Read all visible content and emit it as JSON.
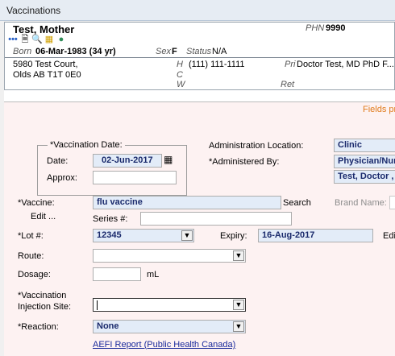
{
  "window": {
    "title": "Vaccinations"
  },
  "patient": {
    "name": "Test, Mother",
    "phn_label": "PHN",
    "phn": "9990",
    "born_label": "Born",
    "born": "06-Mar-1983 (34 yr)",
    "sex_label": "Sex",
    "sex": "F",
    "status_label": "Status",
    "status": "N/A",
    "address_line1": "5980 Test Court,",
    "address_line2": "Olds AB  T1T 0E0",
    "h_label": "H",
    "h_phone": "(111) 111-1111",
    "c_label": "C",
    "w_label": "W",
    "pri_label": "Pri",
    "pri": "Doctor Test, MD PhD F...",
    "ret_label": "Ret"
  },
  "form": {
    "fields_note": "Fields pr",
    "vaccination_date_group": "*Vaccination Date:",
    "date_label": "Date:",
    "date_value": "02-Jun-2017",
    "approx_label": "Approx:",
    "admin_location_label": "Administration Location:",
    "admin_location_value": "Clinic",
    "administered_by_label": "*Administered By:",
    "administered_by_value1": "Physician/Nur",
    "administered_by_value2": "Test, Doctor ,",
    "vaccine_label": "*Vaccine:",
    "vaccine_value": "flu vaccine",
    "search_label": "Search",
    "brand_name_label": "Brand Name:",
    "edit_label": "Edit ...",
    "series_label": "Series #:",
    "lot_label": "*Lot #:",
    "lot_value": "12345",
    "expiry_label": "Expiry:",
    "expiry_value": "16-Aug-2017",
    "edit_right_label": "Edi",
    "route_label": "Route:",
    "dosage_label": "Dosage:",
    "dosage_unit": "mL",
    "injection_site_label1": "*Vaccination",
    "injection_site_label2": "Injection Site:",
    "reaction_label": "*Reaction:",
    "reaction_value": "None",
    "aefi_link": "AEFI Report (Public Health Canada)"
  }
}
